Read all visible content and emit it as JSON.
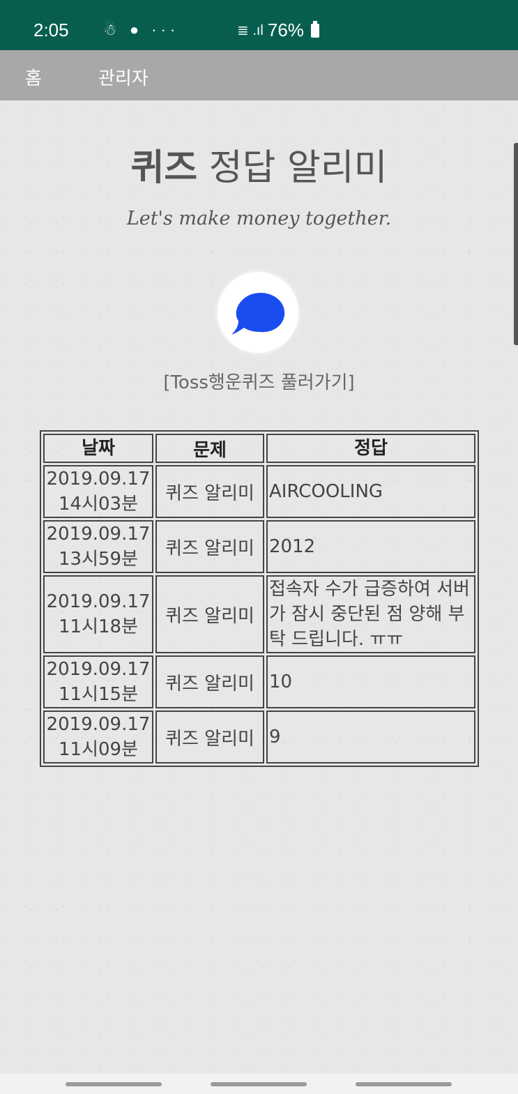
{
  "status_bar": {
    "time": "2:05",
    "left_icons": "☃ ● ···",
    "signal": "≣ .ıl",
    "battery": "76%",
    "background_color": "#075e4e"
  },
  "nav": {
    "home": "홈",
    "admin": "관리자"
  },
  "page": {
    "title_bold": "퀴즈",
    "title_rest": " 정답 알리미",
    "subtitle": "Let's make money together.",
    "logo_icon": "toss-speech-bubble-icon",
    "link_text": "[Toss행운퀴즈 풀러가기]"
  },
  "table": {
    "headers": {
      "date": "날짜",
      "problem": "문제",
      "answer": "정답"
    },
    "rows": [
      {
        "date": "2019.09.17",
        "time": "14시03분",
        "problem": "퀴즈 알리미",
        "answer": "AIRCOOLING"
      },
      {
        "date": "2019.09.17",
        "time": "13시59분",
        "problem": "퀴즈 알리미",
        "answer": "2012"
      },
      {
        "date": "2019.09.17",
        "time": "11시18분",
        "problem": "퀴즈 알리미",
        "answer": "접속자 수가 급증하여 서버가 잠시 중단된 점 양해 부탁 드립니다. ㅠㅠ"
      },
      {
        "date": "2019.09.17",
        "time": "11시15분",
        "problem": "퀴즈 알리미",
        "answer": "10"
      },
      {
        "date": "2019.09.17",
        "time": "11시09분",
        "problem": "퀴즈 알리미",
        "answer": "9"
      }
    ]
  },
  "colors": {
    "nav_background": "#a8a8a8",
    "logo_blue": "#1a4df0"
  }
}
